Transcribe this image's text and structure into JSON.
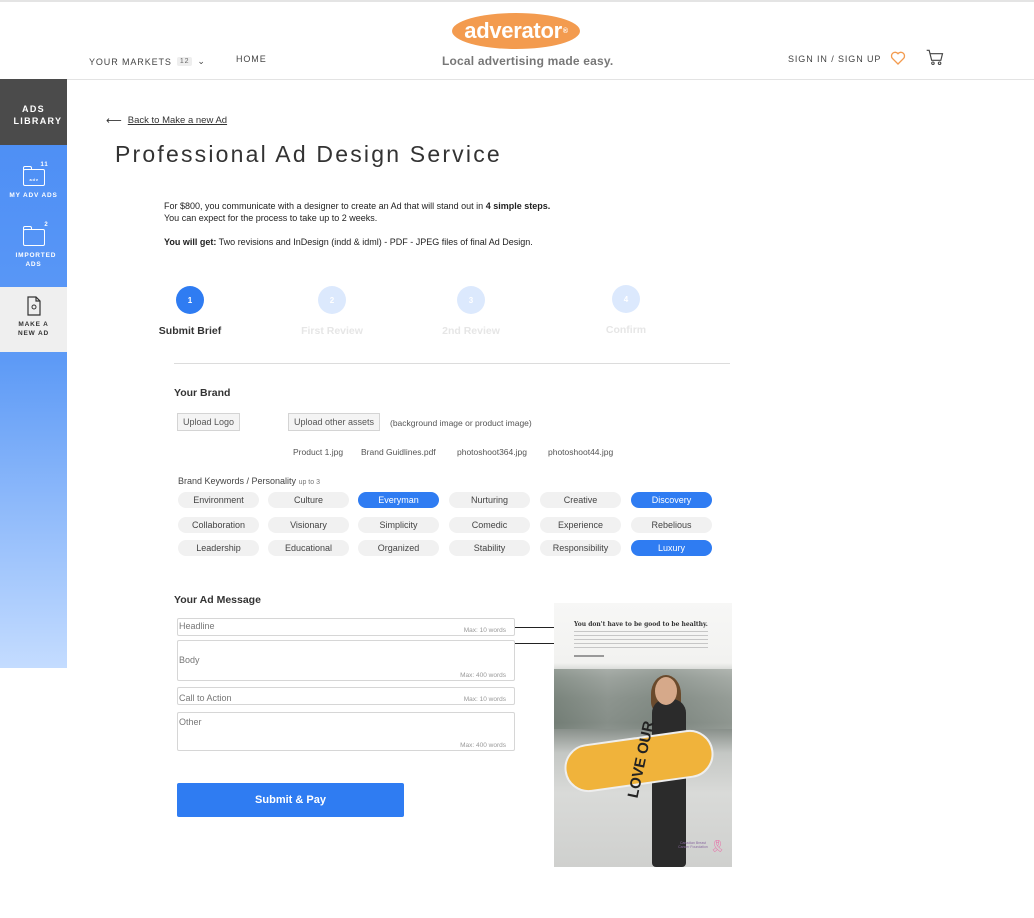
{
  "header": {
    "markets_label": "YOUR MARKETS",
    "markets_count": "12",
    "home_label": "HOME",
    "logo_text": "adverator",
    "logo_mark": "®",
    "tagline": "Local advertising made easy.",
    "signin_label": "SIGN IN / SIGN UP",
    "icons": [
      "chevron-down-icon",
      "heart-icon",
      "cart-icon"
    ],
    "accent_color": "#f39b4f"
  },
  "sidebar": {
    "library_label": "ADS LIBRARY",
    "items": [
      {
        "label": "MY ADV ADS",
        "badge": "11",
        "icon": "folder-icon",
        "mini": "adv"
      },
      {
        "label": "IMPORTED ADS",
        "badge": "2",
        "icon": "folder-icon"
      },
      {
        "label": "MAKE A NEW AD",
        "icon": "document-icon",
        "active": true
      }
    ]
  },
  "page": {
    "back_label": "Back to Make a new Ad",
    "title": "Professional Ad Design Service",
    "intro_line1_pre": "For $800, you communicate with a designer to create an Ad that will stand out in ",
    "intro_line1_bold": "4 simple steps.",
    "intro_line2": "You can expect for the process to take up to 2 weeks.",
    "get_bold": "You will get:",
    "get_rest": " Two revisions and InDesign (indd & idml) - PDF - JPEG  files of final Ad Design."
  },
  "steps": [
    {
      "number": "1",
      "label": "Submit Brief",
      "active": true
    },
    {
      "number": "2",
      "label": "First Review",
      "active": false
    },
    {
      "number": "3",
      "label": "2nd Review",
      "active": false
    },
    {
      "number": "4",
      "label": "Confirm",
      "active": false
    }
  ],
  "brand": {
    "heading": "Your Brand",
    "upload_logo": "Upload Logo",
    "upload_assets": "Upload other assets",
    "assets_note": "(background image or product image)",
    "files": [
      "Product 1.jpg",
      "Brand Guidlines.pdf",
      "photoshoot364.jpg",
      "photoshoot44.jpg"
    ],
    "keywords_label": "Brand Keywords / Personality",
    "keywords_hint": "up to 3",
    "keywords": [
      {
        "label": "Environment",
        "selected": false
      },
      {
        "label": "Culture",
        "selected": false
      },
      {
        "label": "Everyman",
        "selected": true
      },
      {
        "label": "Nurturing",
        "selected": false
      },
      {
        "label": "Creative",
        "selected": false
      },
      {
        "label": "Discovery",
        "selected": true
      },
      {
        "label": "Collaboration",
        "selected": false
      },
      {
        "label": "Visionary",
        "selected": false
      },
      {
        "label": "Simplicity",
        "selected": false
      },
      {
        "label": "Comedic",
        "selected": false
      },
      {
        "label": "Experience",
        "selected": false
      },
      {
        "label": "Rebelious",
        "selected": false
      },
      {
        "label": "Leadership",
        "selected": false
      },
      {
        "label": "Educational",
        "selected": false
      },
      {
        "label": "Organized",
        "selected": false
      },
      {
        "label": "Stability",
        "selected": false
      },
      {
        "label": "Responsibility",
        "selected": false
      },
      {
        "label": "Luxury",
        "selected": true
      }
    ],
    "selected_color": "#2f7cf2"
  },
  "message": {
    "heading": "Your Ad Message",
    "fields": [
      {
        "placeholder": "Headline",
        "max": "Max: 10 words",
        "value": ""
      },
      {
        "placeholder": "Body",
        "max": "Max: 400 words",
        "value": ""
      },
      {
        "placeholder": "Call to Action",
        "max": "Max: 10 words",
        "value": ""
      },
      {
        "placeholder": "Other",
        "max": "Max: 400 words",
        "value": ""
      }
    ],
    "submit_label": "Submit & Pay"
  },
  "ad_preview": {
    "headline": "You don't have to be good to be healthy.",
    "board_text": "LOVE OUR",
    "foundation_text": "Canadian Breast Cancer Foundation",
    "ribbon_icon": "pink-ribbon-icon"
  }
}
